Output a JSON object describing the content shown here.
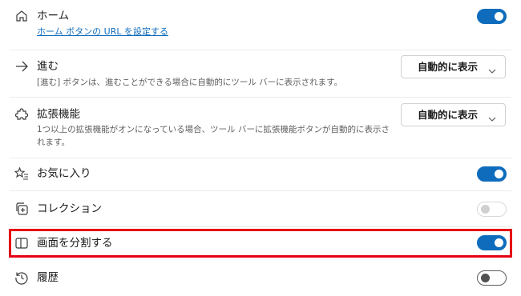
{
  "settings": {
    "home": {
      "title": "ホーム",
      "link": "ホーム ボタンの URL を設定する",
      "toggle_state": "on"
    },
    "forward": {
      "title": "進む",
      "desc": "[進む] ボタンは、進むことができる場合に自動的にツール バーに表示されます。",
      "dropdown": "自動的に表示"
    },
    "extensions": {
      "title": "拡張機能",
      "desc": "1つ以上の拡張機能がオンになっている場合、ツール バーに拡張機能ボタンが自動的に表示されます。",
      "dropdown": "自動的に表示"
    },
    "favorites": {
      "title": "お気に入り",
      "toggle_state": "on"
    },
    "collections": {
      "title": "コレクション",
      "toggle_state": "disabled"
    },
    "split_screen": {
      "title": "画面を分割する",
      "toggle_state": "on",
      "highlighted": true
    },
    "history": {
      "title": "履歴",
      "toggle_state": "off"
    }
  },
  "colors": {
    "accent": "#0f6cbd",
    "highlight": "#e60012"
  },
  "icons": {
    "home": "home-icon",
    "forward": "arrow-right-icon",
    "extensions": "puzzle-icon",
    "favorites": "star-list-icon",
    "collections": "collections-icon",
    "split_screen": "split-screen-icon",
    "history": "history-icon"
  }
}
